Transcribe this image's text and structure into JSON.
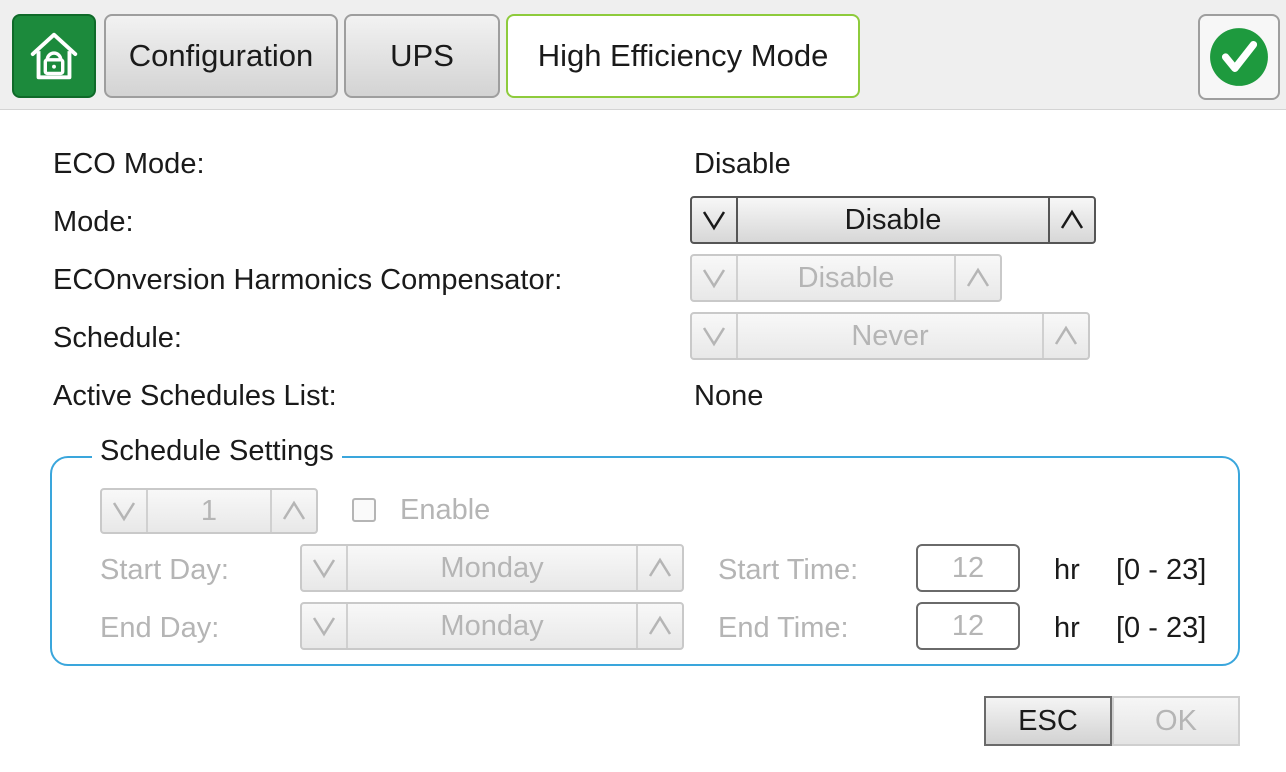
{
  "header": {
    "home_icon": "home-lock-icon",
    "tabs": [
      {
        "label": "Configuration",
        "state": "inactive"
      },
      {
        "label": "UPS",
        "state": "inactive"
      },
      {
        "label": "High Efficiency Mode",
        "state": "active"
      }
    ],
    "confirm_icon": "checkmark-icon"
  },
  "settings": {
    "eco_mode": {
      "label": "ECO Mode:",
      "value": "Disable"
    },
    "mode": {
      "label": "Mode:",
      "value": "Disable",
      "enabled": true
    },
    "harmonics": {
      "label": "ECOnversion Harmonics Compensator:",
      "value": "Disable",
      "enabled": false
    },
    "schedule": {
      "label": "Schedule:",
      "value": "Never",
      "enabled": false
    },
    "active_schedules": {
      "label": "Active Schedules List:",
      "value": "None"
    }
  },
  "schedule_settings": {
    "title": "Schedule Settings",
    "index_value": "1",
    "enable_label": "Enable",
    "enable_checked": false,
    "start_day_label": "Start Day:",
    "start_day_value": "Monday",
    "end_day_label": "End Day:",
    "end_day_value": "Monday",
    "start_time_label": "Start Time:",
    "start_time_value": "12",
    "end_time_label": "End Time:",
    "end_time_value": "12",
    "unit": "hr",
    "range": "[0 - 23]"
  },
  "footer": {
    "esc_label": "ESC",
    "ok_label": "OK"
  },
  "colors": {
    "home_green": "#1c8a3c",
    "active_tab_border": "#8ecb3c",
    "fieldset_border": "#3aa6dc",
    "check_green": "#1e9a3e",
    "disabled_text": "#b5b5b5"
  }
}
